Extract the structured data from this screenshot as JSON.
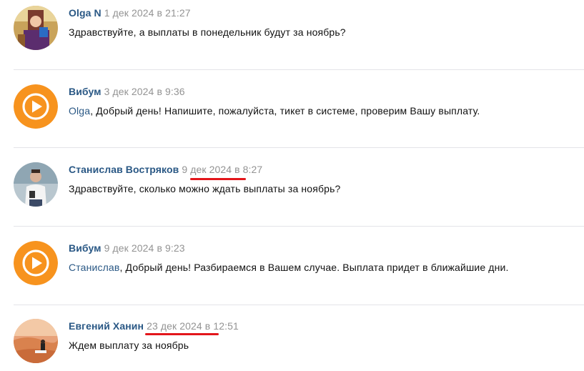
{
  "comments": [
    {
      "author": "Olga N",
      "date": "1 дек 2024",
      "at": "в",
      "time": "21:27",
      "text": "Здравствуйте, а выплаты в понедельник будут за ноябрь?"
    },
    {
      "author": "Вибум",
      "date": "3 дек 2024",
      "at": "в",
      "time": "9:36",
      "mention": "Olga",
      "text": ", Добрый день! Напишите, пожалуйста, тикет в системе, проверим Вашу выплату."
    },
    {
      "author": "Станислав Востряков",
      "date": "9 дек 2024",
      "at": "в",
      "time": "8:27",
      "text": "Здравствуйте, сколько можно ждать выплаты за ноябрь?"
    },
    {
      "author": "Вибум",
      "date": "9 дек 2024",
      "at": "в",
      "time": "9:23",
      "mention": "Станислав",
      "text": ", Добрый день! Разбираемся в Вашем случае. Выплата придет в ближайшие дни."
    },
    {
      "author": "Евгений Ханин",
      "date": "23 дек 2024",
      "at": "в",
      "time": "12:51",
      "text": "Ждем выплату за ноябрь"
    }
  ],
  "colors": {
    "link": "#2a5885",
    "meta": "#939393",
    "brand_orange": "#f7931e",
    "annotation_red": "#e3161b"
  },
  "icons": {
    "brand_avatar": "play-circle-icon"
  }
}
